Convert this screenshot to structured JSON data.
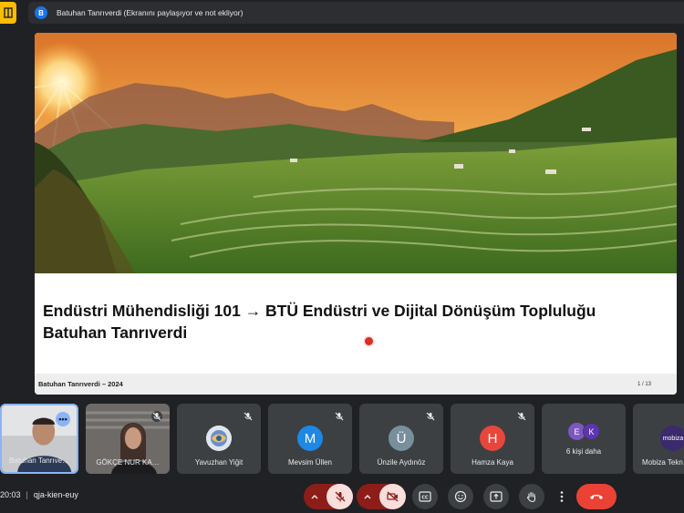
{
  "top_bar": {
    "presenter_initial": "B",
    "sharing_text": "Batuhan Tanrıverdi (Ekranını paylaşıyor ve not ekliyor)"
  },
  "slide": {
    "title_line1": "Endüstri Mühendisliği 101 → BTÜ Endüstri ve Dijital Dönüşüm Topluluğu",
    "title_line2": "Batuhan Tanrıverdi",
    "footer_left": "Batuhan Tanrıverdi – 2024",
    "footer_right": "1 / 13"
  },
  "participants": [
    {
      "name": "Batuhan Tanrıverdi",
      "display": "Batuhan Tanrıve…",
      "video": true,
      "muted": false
    },
    {
      "name": "GÖKÇE NUR KA…",
      "video": true,
      "muted": true
    },
    {
      "name": "Yavuzhan Yiğit",
      "muted": true
    },
    {
      "name": "Mevsim Üllen",
      "initial": "M",
      "color": "#1e88e5",
      "muted": true
    },
    {
      "name": "Ünzile Aydınöz",
      "initial": "Ü",
      "color": "#78909c",
      "muted": true
    },
    {
      "name": "Hamza Kaya",
      "initial": "H",
      "color": "#e8453c",
      "muted": true
    },
    {
      "name": "6 kişi daha",
      "initials": [
        "E",
        "K"
      ]
    },
    {
      "name": "Mobiza Tekn…",
      "logo_text": "mobiza"
    }
  ],
  "more_options_glyph": "•••",
  "meeting": {
    "time": "20:03",
    "separator": "|",
    "code": "qja-kien-euy"
  },
  "icons": {
    "brand": "meet-presenter-icon",
    "mic": "mic-off-icon",
    "camera": "camera-off-icon",
    "captions": "captions-icon",
    "emoji": "emoji-icon",
    "present": "present-screen-icon",
    "hand": "raise-hand-icon",
    "more": "more-vert-icon",
    "leave": "call-end-icon"
  },
  "colors": {
    "background": "#202124",
    "tile": "#3c4043",
    "danger": "#ea4335",
    "accent": "#8ab4f8"
  }
}
